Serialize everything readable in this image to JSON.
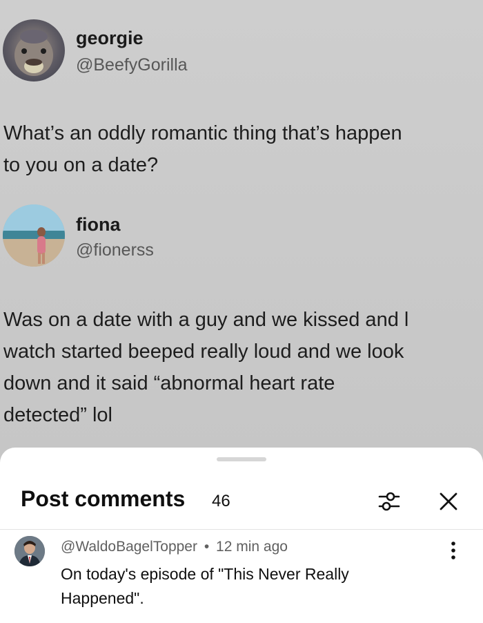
{
  "tweet": {
    "author_name": "georgie",
    "author_handle": "@BeefyGorilla",
    "text_line1": "What’s an oddly romantic thing that’s happen",
    "text_line2": "to you on a date?"
  },
  "reply": {
    "author_name": "fiona",
    "author_handle": "@fionerss",
    "text_line1": "Was on a date with a guy and we kissed and l",
    "text_line2": "watch started beeped really loud and we look",
    "text_line3": "down and it said “abnormal heart rate",
    "text_line4": "detected” lol"
  },
  "sheet": {
    "title": "Post comments",
    "count": "46",
    "filter_icon": "sliders-icon",
    "close_icon": "close-icon"
  },
  "comment": {
    "handle": "@WaldoBagelTopper",
    "separator": "•",
    "time": "12 min ago",
    "body": "On today's episode of \"This Never Really Happened\".",
    "more_icon": "more-vertical-icon"
  }
}
